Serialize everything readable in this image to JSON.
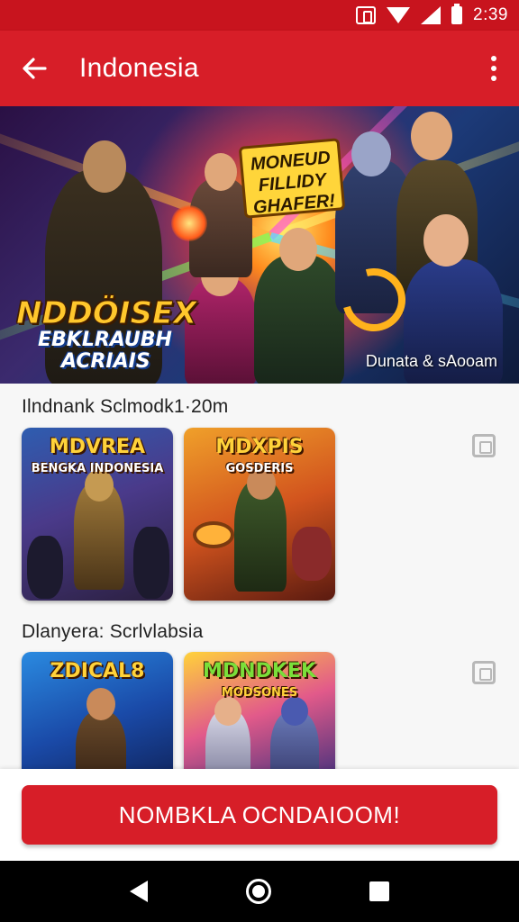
{
  "status_bar": {
    "time": "2:39",
    "icons": [
      "vibrate-icon",
      "wifi-icon",
      "signal-icon",
      "battery-icon"
    ]
  },
  "app_bar": {
    "title": "Indonesia",
    "back_icon": "arrow-left-icon",
    "menu_icon": "more-vertical-icon"
  },
  "hero": {
    "logo_line1": "NDDÖISEX",
    "logo_line2": "EBKLRAUBH",
    "logo_line3": "ACRIAIS",
    "badge_text": "MONEUD FILLIDY GHAFER!",
    "caption": "Dunata & sAooam"
  },
  "sections": [
    {
      "title": "Ilndnank Sclmodk1·20m",
      "copy_icon": "copy-icon",
      "tiles": [
        {
          "title": "MDVREA",
          "subtitle": "BENGKA INDONESIA"
        },
        {
          "title": "MDXPIS",
          "subtitle": "GOSDERIS"
        }
      ]
    },
    {
      "title": "Dlanyera: Scrlvlabsia",
      "copy_icon": "copy-icon",
      "tiles": [
        {
          "title": "ZDICAL8",
          "subtitle": ""
        },
        {
          "title": "MDNDKEK",
          "subtitle": "MODSONES"
        }
      ]
    }
  ],
  "cta": {
    "label": "NOMBKLA OCNDAIOOM!"
  },
  "nav_bar": {
    "icons": [
      "nav-back-icon",
      "nav-home-icon",
      "nav-recents-icon"
    ]
  },
  "colors": {
    "primary": "#d71e28",
    "status_bar": "#c8141e",
    "background": "#f7f7f7"
  }
}
